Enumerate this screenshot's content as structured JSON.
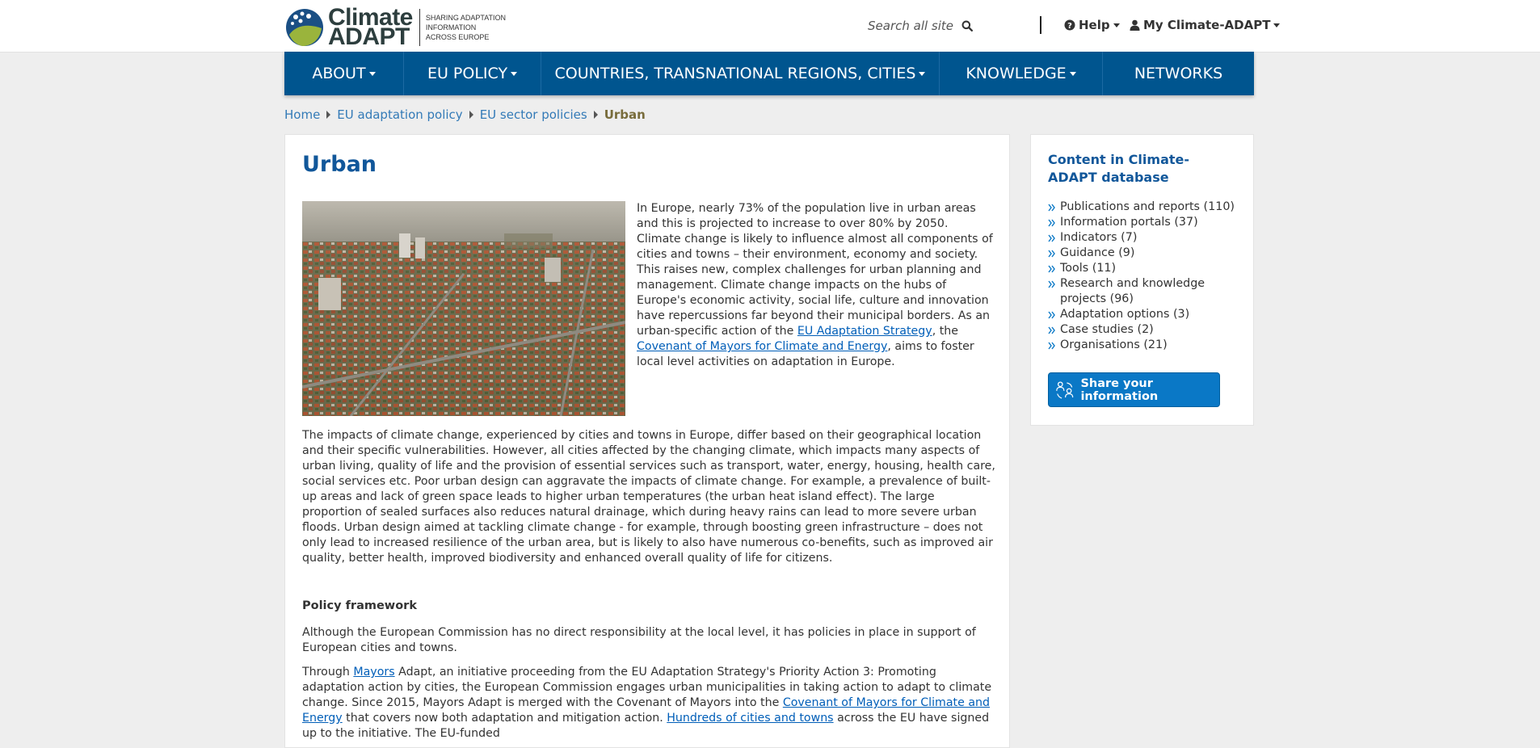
{
  "header": {
    "logo_line1": "Climate",
    "logo_line2": "ADAPT",
    "tagline": [
      "SHARING ADAPTATION",
      "INFORMATION",
      "ACROSS EUROPE"
    ],
    "search_placeholder": "Search all site ...",
    "help_label": "Help",
    "my_account_label": "My Climate-ADAPT"
  },
  "nav": {
    "items": [
      {
        "label": "ABOUT",
        "dropdown": true
      },
      {
        "label": "EU POLICY",
        "dropdown": true
      },
      {
        "label": "COUNTRIES, TRANSNATIONAL REGIONS, CITIES",
        "dropdown": true
      },
      {
        "label": "KNOWLEDGE",
        "dropdown": true
      },
      {
        "label": "NETWORKS",
        "dropdown": false
      }
    ]
  },
  "breadcrumb": {
    "items": [
      "Home",
      "EU adaptation policy",
      "EU sector policies"
    ],
    "current": "Urban"
  },
  "main": {
    "title": "Urban",
    "intro": {
      "text1": "In Europe, nearly 73% of the population live in urban areas and this is projected to increase to over 80% by 2050. Climate change is likely to influence almost all components of cities and towns – their environment, economy and society.  This raises new, complex challenges for urban planning and management. Climate change impacts on the hubs of Europe's economic activity, social life, culture and innovation have repercussions far beyond their municipal borders. As an urban-specific action of the ",
      "link1": "EU Adaptation Strategy",
      "text2": ", the ",
      "link2": "Covenant of Mayors for Climate and Energy",
      "text3": ", aims to foster local level activities on adaptation in Europe."
    },
    "impacts": "The impacts of climate change, experienced by cities and towns in Europe, differ based on their geographical location and their specific vulnerabilities. However, all cities affected by the changing climate, which impacts many aspects of urban living, quality of life and the provision of essential services such as transport, water, energy, housing, health care, social services etc. Poor urban design can aggravate the impacts of climate change. For example, a prevalence of built-up areas and lack of green space leads to higher urban temperatures (the urban heat island effect). The large proportion of sealed surfaces also reduces natural drainage, which during heavy rains can lead to more severe urban floods. Urban design aimed at tackling climate change - for example, through boosting green infrastructure – does not only lead to increased resilience of the urban area, but is likely to also have numerous co-benefits, such as improved air quality, better health, improved biodiversity and enhanced overall quality of life for citizens.",
    "policy_heading": "Policy framework",
    "policy_ec": "Although the European Commission has no direct responsibility at the local level, it has policies in place in support of European cities and towns.",
    "mayors": {
      "t1": "Through ",
      "l1": "Mayors",
      "t2": " Adapt, an initiative proceeding from the EU Adaptation Strategy's Priority Action 3: Promoting adaptation action by cities, the European Commission engages urban municipalities in taking action to adapt to climate change. Since 2015, Mayors Adapt is merged with the Covenant of Mayors into the ",
      "l2": "Covenant of Mayors for Climate and Energy",
      "t3": " that covers now both adaptation and mitigation action. ",
      "l3": "Hundreds of cities and towns",
      "t4": " across the EU have signed up to the initiative. The EU-funded"
    }
  },
  "sidebar": {
    "title": "Content in Climate-ADAPT database",
    "items": [
      "Publications and reports (110)",
      "Information portals (37)",
      "Indicators (7)",
      "Guidance (9)",
      "Tools (11)",
      "Research and knowledge projects (96)",
      "Adaptation options (3)",
      "Case studies (2)",
      "Organisations (21)"
    ],
    "share_button": "Share your information"
  },
  "colors": {
    "nav_bg": "#00558f",
    "title_blue": "#11579a",
    "link_blue": "#005eb8",
    "button_blue": "#0a78c6",
    "breadcrumb_current": "#786c3b"
  }
}
